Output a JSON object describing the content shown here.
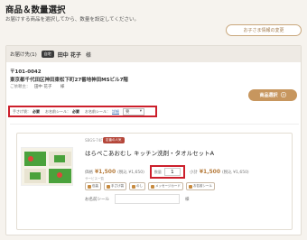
{
  "header": {
    "title": "商品＆数量選択",
    "subtitle": "お届けする商品を選択してから、数量を設定してください。",
    "change_kids_label": "お子さま情報の変更"
  },
  "recipient": {
    "header_label": "お届け先(1)",
    "badge": "自宅",
    "name": "田中 花子",
    "honorific": "様",
    "postal": "〒101-0042",
    "address": "東京都千代田区神田東松下町27番地神田MSビル7階",
    "sender_label": "ご依頼主：",
    "sender_name": "田中 花子",
    "sender_honorific": "様"
  },
  "select_button": {
    "label": "商品選択",
    "icon": "arrow-right-icon"
  },
  "wrapping": {
    "noshi_label": "手さげ袋：",
    "noshi_value": "必要",
    "meishi_label": "お名前シール：",
    "meishi_value": "必要",
    "omote_label": "お名前シール：",
    "omote_link": "詳細",
    "select_value": "要"
  },
  "product": {
    "sku": "SBGS-74F",
    "tag": "定番の人気",
    "name": "はらぺこあおむし キッチン洗剤・タオルセットA",
    "price_label": "価格",
    "price": "¥1,500",
    "tax": "(税込 ¥1,650)",
    "qty_label": "数量",
    "qty_value": "1",
    "subtotal_label": "小計",
    "subtotal": "¥1,500",
    "subtotal_tax": "(税込 ¥1,650)",
    "services_label": "サービス一覧",
    "services": [
      "包装",
      "手さげ袋",
      "のし",
      "メッセージカード",
      "お名前シール"
    ],
    "name_sticker_label": "お名前シール",
    "name_sticker_honorific": "様"
  }
}
